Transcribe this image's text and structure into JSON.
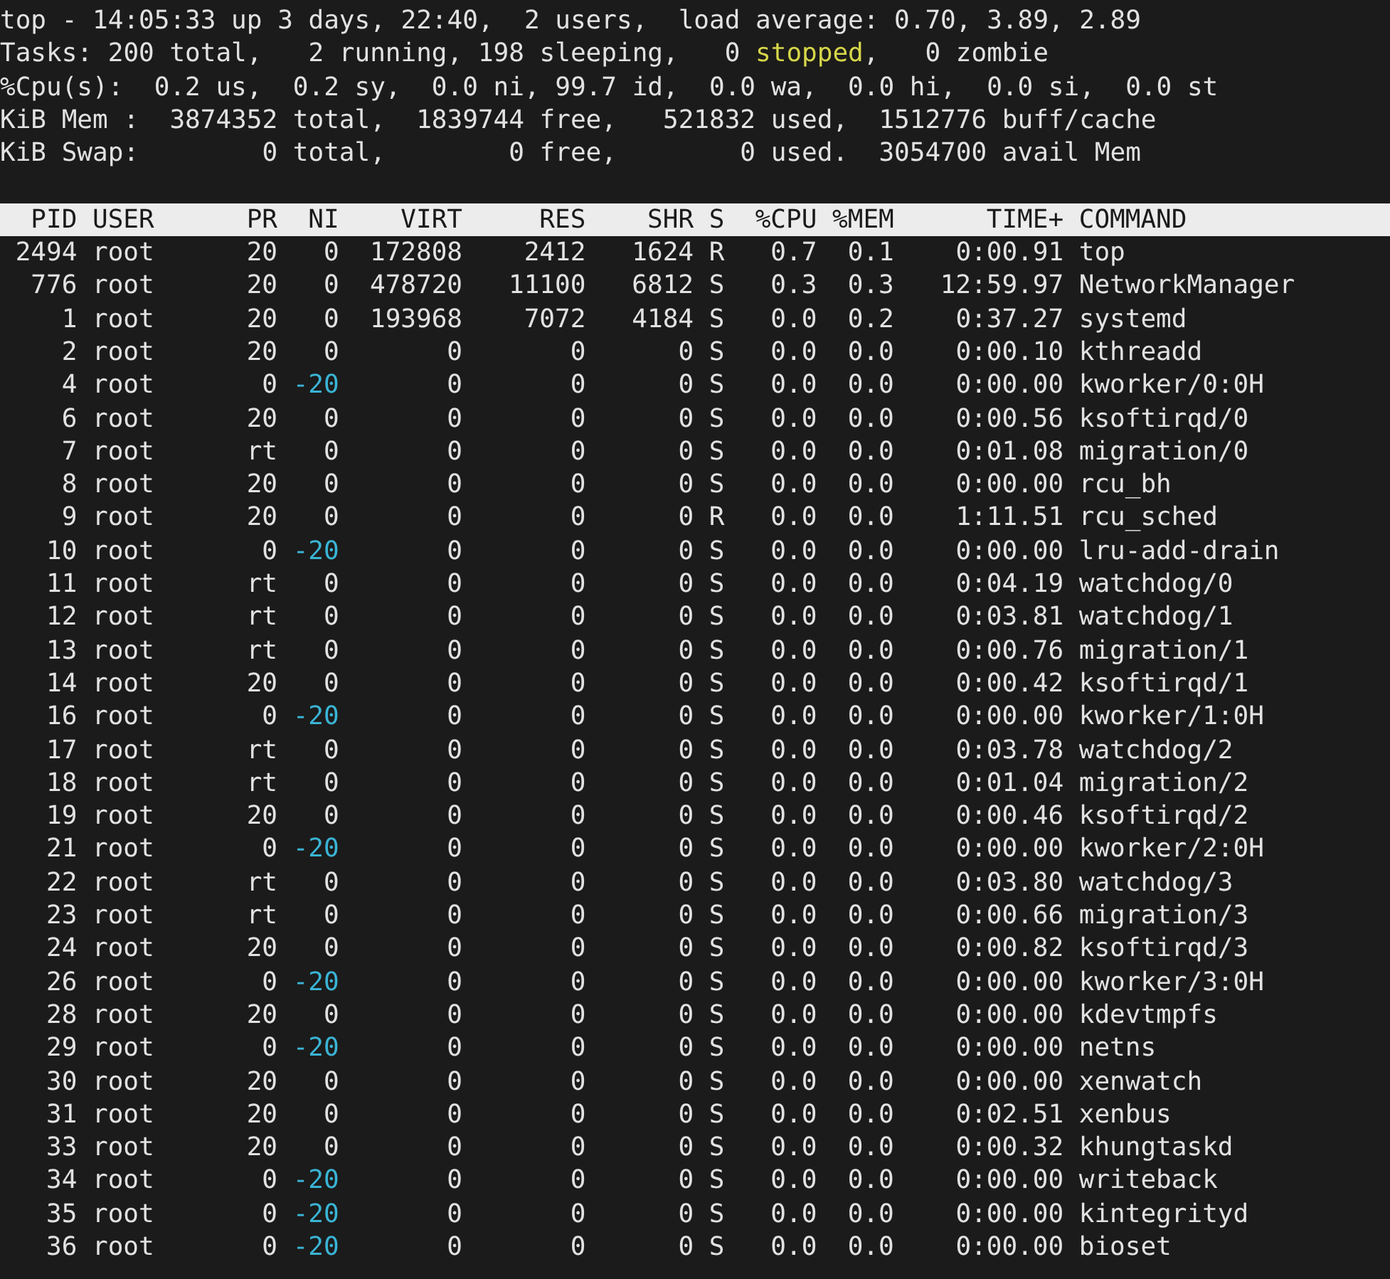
{
  "summary": [
    [
      {
        "text": "top - 14:05:33 up 3 days, 22:40,  2 users,  load average: 0.70, 3.89, 2.89",
        "kind": "normal"
      }
    ],
    [
      {
        "text": "Tasks: 200 total,   2 running, 198 sleeping,   0 ",
        "kind": "normal"
      },
      {
        "text": "stopped",
        "kind": "alert"
      },
      {
        "text": ",   0 zombie",
        "kind": "normal"
      }
    ],
    [
      {
        "text": "%Cpu(s):  0.2 us,  0.2 sy,  0.0 ni, 99.7 id,  0.0 wa,  0.0 hi,  0.0 si,  0.0 st",
        "kind": "normal"
      }
    ],
    [
      {
        "text": "KiB Mem :  3874352 total,  1839744 free,   521832 used,  1512776 buff/cache",
        "kind": "normal"
      }
    ],
    [
      {
        "text": "KiB Swap:        0 total,        0 free,        0 used.  3054700 avail Mem",
        "kind": "normal"
      }
    ]
  ],
  "table": {
    "columns": [
      "PID",
      "USER",
      "PR",
      "NI",
      "VIRT",
      "RES",
      "SHR",
      "S",
      "%CPU",
      "%MEM",
      "TIME+",
      "COMMAND"
    ],
    "rows": [
      {
        "cells": [
          "2494",
          "root",
          "20",
          "0",
          "172808",
          "2412",
          "1624",
          "R",
          "0.7",
          "0.1",
          "0:00.91",
          "top"
        ],
        "negative_nice": false
      },
      {
        "cells": [
          "776",
          "root",
          "20",
          "0",
          "478720",
          "11100",
          "6812",
          "S",
          "0.3",
          "0.3",
          "12:59.97",
          "NetworkManager"
        ],
        "negative_nice": false
      },
      {
        "cells": [
          "1",
          "root",
          "20",
          "0",
          "193968",
          "7072",
          "4184",
          "S",
          "0.0",
          "0.2",
          "0:37.27",
          "systemd"
        ],
        "negative_nice": false
      },
      {
        "cells": [
          "2",
          "root",
          "20",
          "0",
          "0",
          "0",
          "0",
          "S",
          "0.0",
          "0.0",
          "0:00.10",
          "kthreadd"
        ],
        "negative_nice": false
      },
      {
        "cells": [
          "4",
          "root",
          "0",
          "-20",
          "0",
          "0",
          "0",
          "S",
          "0.0",
          "0.0",
          "0:00.00",
          "kworker/0:0H"
        ],
        "negative_nice": true
      },
      {
        "cells": [
          "6",
          "root",
          "20",
          "0",
          "0",
          "0",
          "0",
          "S",
          "0.0",
          "0.0",
          "0:00.56",
          "ksoftirqd/0"
        ],
        "negative_nice": false
      },
      {
        "cells": [
          "7",
          "root",
          "rt",
          "0",
          "0",
          "0",
          "0",
          "S",
          "0.0",
          "0.0",
          "0:01.08",
          "migration/0"
        ],
        "negative_nice": false
      },
      {
        "cells": [
          "8",
          "root",
          "20",
          "0",
          "0",
          "0",
          "0",
          "S",
          "0.0",
          "0.0",
          "0:00.00",
          "rcu_bh"
        ],
        "negative_nice": false
      },
      {
        "cells": [
          "9",
          "root",
          "20",
          "0",
          "0",
          "0",
          "0",
          "R",
          "0.0",
          "0.0",
          "1:11.51",
          "rcu_sched"
        ],
        "negative_nice": false
      },
      {
        "cells": [
          "10",
          "root",
          "0",
          "-20",
          "0",
          "0",
          "0",
          "S",
          "0.0",
          "0.0",
          "0:00.00",
          "lru-add-drain"
        ],
        "negative_nice": true
      },
      {
        "cells": [
          "11",
          "root",
          "rt",
          "0",
          "0",
          "0",
          "0",
          "S",
          "0.0",
          "0.0",
          "0:04.19",
          "watchdog/0"
        ],
        "negative_nice": false
      },
      {
        "cells": [
          "12",
          "root",
          "rt",
          "0",
          "0",
          "0",
          "0",
          "S",
          "0.0",
          "0.0",
          "0:03.81",
          "watchdog/1"
        ],
        "negative_nice": false
      },
      {
        "cells": [
          "13",
          "root",
          "rt",
          "0",
          "0",
          "0",
          "0",
          "S",
          "0.0",
          "0.0",
          "0:00.76",
          "migration/1"
        ],
        "negative_nice": false
      },
      {
        "cells": [
          "14",
          "root",
          "20",
          "0",
          "0",
          "0",
          "0",
          "S",
          "0.0",
          "0.0",
          "0:00.42",
          "ksoftirqd/1"
        ],
        "negative_nice": false
      },
      {
        "cells": [
          "16",
          "root",
          "0",
          "-20",
          "0",
          "0",
          "0",
          "S",
          "0.0",
          "0.0",
          "0:00.00",
          "kworker/1:0H"
        ],
        "negative_nice": true
      },
      {
        "cells": [
          "17",
          "root",
          "rt",
          "0",
          "0",
          "0",
          "0",
          "S",
          "0.0",
          "0.0",
          "0:03.78",
          "watchdog/2"
        ],
        "negative_nice": false
      },
      {
        "cells": [
          "18",
          "root",
          "rt",
          "0",
          "0",
          "0",
          "0",
          "S",
          "0.0",
          "0.0",
          "0:01.04",
          "migration/2"
        ],
        "negative_nice": false
      },
      {
        "cells": [
          "19",
          "root",
          "20",
          "0",
          "0",
          "0",
          "0",
          "S",
          "0.0",
          "0.0",
          "0:00.46",
          "ksoftirqd/2"
        ],
        "negative_nice": false
      },
      {
        "cells": [
          "21",
          "root",
          "0",
          "-20",
          "0",
          "0",
          "0",
          "S",
          "0.0",
          "0.0",
          "0:00.00",
          "kworker/2:0H"
        ],
        "negative_nice": true
      },
      {
        "cells": [
          "22",
          "root",
          "rt",
          "0",
          "0",
          "0",
          "0",
          "S",
          "0.0",
          "0.0",
          "0:03.80",
          "watchdog/3"
        ],
        "negative_nice": false
      },
      {
        "cells": [
          "23",
          "root",
          "rt",
          "0",
          "0",
          "0",
          "0",
          "S",
          "0.0",
          "0.0",
          "0:00.66",
          "migration/3"
        ],
        "negative_nice": false
      },
      {
        "cells": [
          "24",
          "root",
          "20",
          "0",
          "0",
          "0",
          "0",
          "S",
          "0.0",
          "0.0",
          "0:00.82",
          "ksoftirqd/3"
        ],
        "negative_nice": false
      },
      {
        "cells": [
          "26",
          "root",
          "0",
          "-20",
          "0",
          "0",
          "0",
          "S",
          "0.0",
          "0.0",
          "0:00.00",
          "kworker/3:0H"
        ],
        "negative_nice": true
      },
      {
        "cells": [
          "28",
          "root",
          "20",
          "0",
          "0",
          "0",
          "0",
          "S",
          "0.0",
          "0.0",
          "0:00.00",
          "kdevtmpfs"
        ],
        "negative_nice": false
      },
      {
        "cells": [
          "29",
          "root",
          "0",
          "-20",
          "0",
          "0",
          "0",
          "S",
          "0.0",
          "0.0",
          "0:00.00",
          "netns"
        ],
        "negative_nice": true
      },
      {
        "cells": [
          "30",
          "root",
          "20",
          "0",
          "0",
          "0",
          "0",
          "S",
          "0.0",
          "0.0",
          "0:00.00",
          "xenwatch"
        ],
        "negative_nice": false
      },
      {
        "cells": [
          "31",
          "root",
          "20",
          "0",
          "0",
          "0",
          "0",
          "S",
          "0.0",
          "0.0",
          "0:02.51",
          "xenbus"
        ],
        "negative_nice": false
      },
      {
        "cells": [
          "33",
          "root",
          "20",
          "0",
          "0",
          "0",
          "0",
          "S",
          "0.0",
          "0.0",
          "0:00.32",
          "khungtaskd"
        ],
        "negative_nice": false
      },
      {
        "cells": [
          "34",
          "root",
          "0",
          "-20",
          "0",
          "0",
          "0",
          "S",
          "0.0",
          "0.0",
          "0:00.00",
          "writeback"
        ],
        "negative_nice": true
      },
      {
        "cells": [
          "35",
          "root",
          "0",
          "-20",
          "0",
          "0",
          "0",
          "S",
          "0.0",
          "0.0",
          "0:00.00",
          "kintegrityd"
        ],
        "negative_nice": true
      },
      {
        "cells": [
          "36",
          "root",
          "0",
          "-20",
          "0",
          "0",
          "0",
          "S",
          "0.0",
          "0.0",
          "0:00.00",
          "bioset"
        ],
        "negative_nice": true
      }
    ]
  }
}
